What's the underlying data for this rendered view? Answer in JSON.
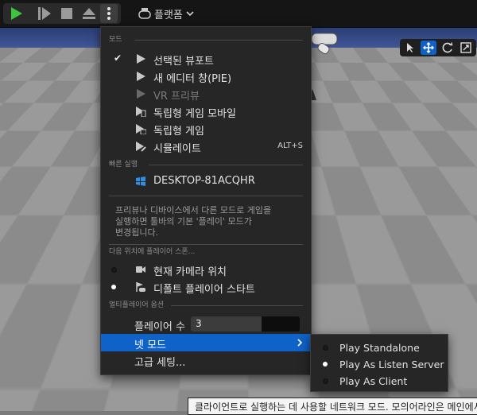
{
  "toolbar": {
    "play_icon": "play-icon",
    "frame_advance_icon": "frame-skip-icon",
    "stop_icon": "stop-icon",
    "eject_icon": "eject-icon",
    "more_icon": "kebab-icon",
    "platform_label": "플랫폼",
    "accent": "#3ec33e"
  },
  "menu": {
    "section_mode": "모드",
    "mode_items": [
      {
        "label": "선택된 뷰포트",
        "checked": true,
        "enabled": true,
        "icon": "play-triangle-icon"
      },
      {
        "label": "새 에디터 창(PIE)",
        "checked": false,
        "enabled": true,
        "icon": "play-triangle-icon"
      },
      {
        "label": "VR 프리뷰",
        "checked": false,
        "enabled": false,
        "icon": "play-triangle-icon"
      },
      {
        "label": "독립형 게임 모바일",
        "checked": false,
        "enabled": true,
        "icon": "mobile-play-icon"
      },
      {
        "label": "독립형 게임",
        "checked": false,
        "enabled": true,
        "icon": "standalone-play-icon"
      },
      {
        "label": "시뮬레이트",
        "checked": false,
        "enabled": true,
        "icon": "simulate-icon",
        "shortcut": "ALT+S"
      }
    ],
    "section_quick": "빠른 실행",
    "quick_item": {
      "label": "DESKTOP-81ACQHR",
      "icon": "windows-icon"
    },
    "note_lines": [
      "프리뷰나 디바이스에서 다른 모드로 게임을",
      "실행하면 툴바의 기본 '플레이' 모드가",
      "변경됩니다."
    ],
    "section_spawn": "다음 위치에 플레이어 스폰...",
    "spawn_items": [
      {
        "label": "현재 카메라 위치",
        "selected": false,
        "icon": "camera-icon"
      },
      {
        "label": "디폴트 플레이어 스타트",
        "selected": true,
        "icon": "player-start-icon"
      }
    ],
    "section_multiplayer": "멀티플레이어 옵션",
    "players_label": "플레이어 수",
    "players_value": "3",
    "players_fill_fraction": 0.65,
    "net_mode_label": "넷 모드",
    "advanced_label": "고급 세팅..."
  },
  "submenu": {
    "items": [
      {
        "label": "Play Standalone",
        "selected": false
      },
      {
        "label": "Play As Listen Server",
        "selected": true
      },
      {
        "label": "Play As Client",
        "selected": false
      }
    ]
  },
  "viewport_tools": [
    "select-arrow-icon",
    "move-icon",
    "rotate-icon",
    "scale-icon"
  ],
  "tooltip": {
    "text": "클라이언트로 실행하는 데 사용할 네트워크 모드. 모의어라인은 메인에서 ..."
  },
  "colors": {
    "selection": "#0f62c8",
    "menu_bg": "#262626",
    "toolbar_bg": "#151515",
    "play_green": "#3ec33e"
  }
}
